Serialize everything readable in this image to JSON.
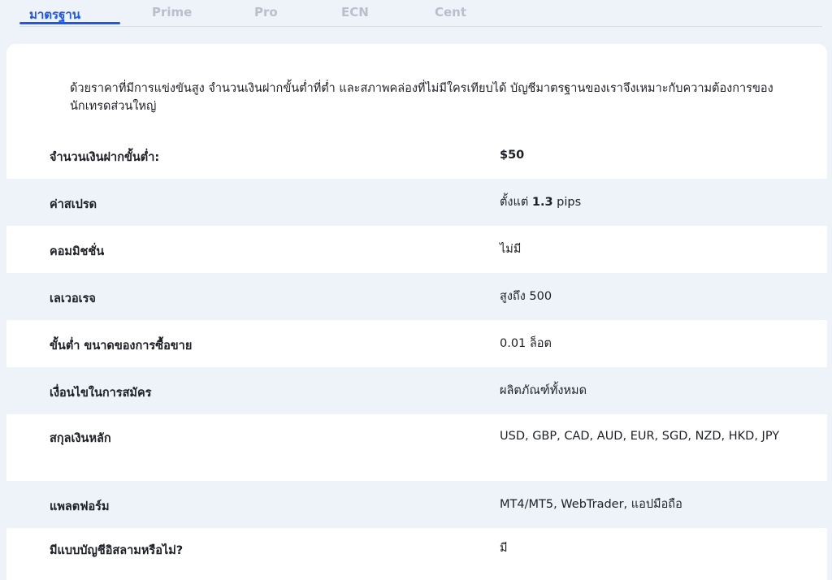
{
  "tabs": [
    {
      "label": "มาตรฐาน",
      "active": true
    },
    {
      "label": "Prime",
      "active": false
    },
    {
      "label": "Pro",
      "active": false
    },
    {
      "label": "ECN",
      "active": false
    },
    {
      "label": "Cent",
      "active": false
    }
  ],
  "account": {
    "description": "ด้วยราคาที่มีการแข่งขันสูง จำนวนเงินฝากขั้นต่ำที่ต่ำ และสภาพคล่องที่ไม่มีใครเทียบได้ บัญชีมาตรฐานของเราจึงเหมาะกับความต้องการของนักเทรดส่วนใหญ่",
    "rows": [
      {
        "label": "จำนวนเงินฝากขั้นต่ำ:",
        "value": "$50"
      },
      {
        "label": "ค่าสเปรด",
        "value_prefix": "ตั้งแต่ ",
        "value_bold": "1.3",
        "value_suffix": " pips"
      },
      {
        "label": "คอมมิชชั่น",
        "value": "ไม่มี"
      },
      {
        "label": "เลเวอเรจ",
        "value": "สูงถึง 500"
      },
      {
        "label": "ขั้นต่ำ ขนาดของการซื้อขาย",
        "value": "0.01 ล็อต"
      },
      {
        "label": "เงื่อนไขในการสมัคร",
        "value": "ผลิตภัณฑ์ทั้งหมด"
      },
      {
        "label": "สกุลเงินหลัก",
        "value": "USD, GBP, CAD, AUD, EUR, SGD, NZD, HKD, JPY"
      },
      {
        "label": "แพลตฟอร์ม",
        "value": "MT4/MT5, WebTrader, แอปมือถือ"
      },
      {
        "label": "มีแบบบัญชีอิสลามหรือไม่?",
        "value": "มี"
      }
    ]
  }
}
